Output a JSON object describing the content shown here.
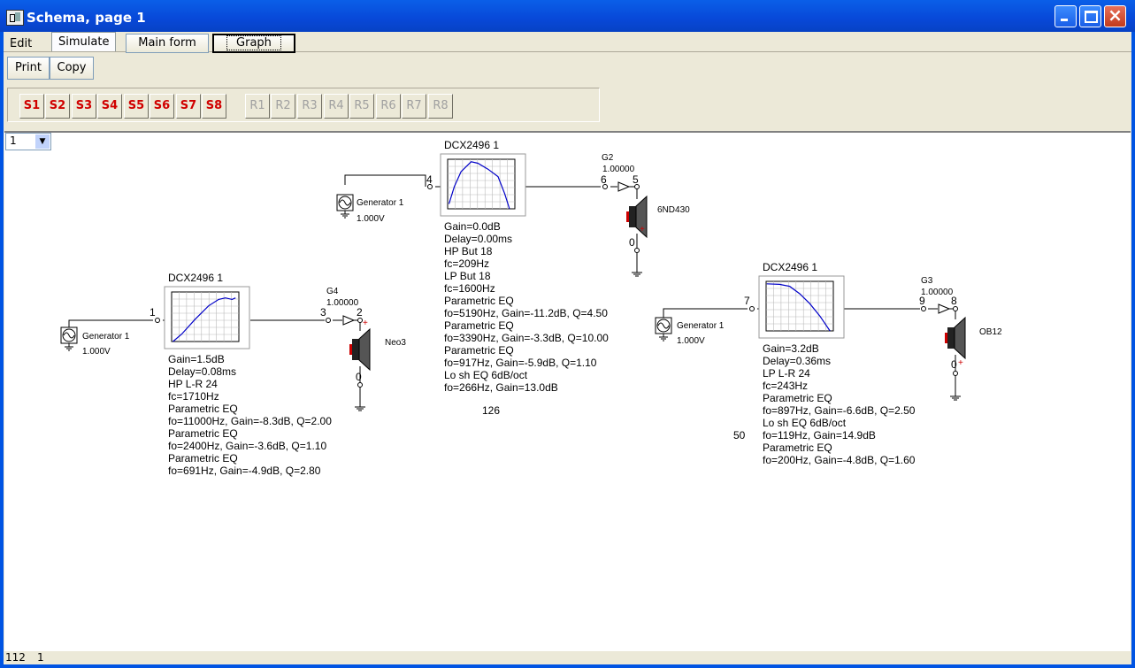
{
  "window": {
    "title": "Schema, page 1"
  },
  "menu": {
    "edit": "Edit",
    "simulate": "Simulate",
    "main_form": "Main form",
    "graph": "Graph",
    "print": "Print",
    "copy": "Copy"
  },
  "presets": {
    "s": [
      "S1",
      "S2",
      "S3",
      "S4",
      "S5",
      "S6",
      "S7",
      "S8"
    ],
    "r": [
      "R1",
      "R2",
      "R3",
      "R4",
      "R5",
      "R6",
      "R7",
      "R8"
    ]
  },
  "page_select": {
    "value": "1"
  },
  "schematic": {
    "ch2": {
      "gen_label": "Generator 1",
      "gen_volt": "1.000V",
      "in_node": "4",
      "dsp_title": "DCX2496 1",
      "out_node": "6",
      "amp_label": "G2",
      "amp_gain": "1.00000",
      "spk_node": "5",
      "spk_gnd_node": "0",
      "speaker": "6ND430",
      "params": [
        "Gain=0.0dB",
        "Delay=0.00ms",
        "HP But 18",
        " fc=209Hz",
        "LP But 18",
        " fc=1600Hz",
        "Parametric EQ",
        " fo=5190Hz, Gain=-11.2dB, Q=4.50",
        "Parametric EQ",
        " fo=3390Hz, Gain=-3.3dB, Q=10.00",
        "Parametric EQ",
        " fo=917Hz, Gain=-5.9dB, Q=1.10",
        "Lo sh EQ 6dB/oct",
        " fo=266Hz, Gain=13.0dB"
      ],
      "note": "126"
    },
    "ch1": {
      "gen_label": "Generator 1",
      "gen_volt": "1.000V",
      "in_node": "1",
      "dsp_title": "DCX2496 1",
      "out_node": "3",
      "amp_label": "G4",
      "amp_gain": "1.00000",
      "spk_node": "2",
      "spk_gnd_node": "0",
      "speaker": "Neo3",
      "params": [
        "Gain=1.5dB",
        "Delay=0.08ms",
        "HP L-R 24",
        " fc=1710Hz",
        "Parametric EQ",
        " fo=11000Hz, Gain=-8.3dB, Q=2.00",
        "Parametric EQ",
        " fo=2400Hz, Gain=-3.6dB, Q=1.10",
        "Parametric EQ",
        " fo=691Hz, Gain=-4.9dB, Q=2.80"
      ]
    },
    "ch3": {
      "gen_label": "Generator 1",
      "gen_volt": "1.000V",
      "in_node": "7",
      "dsp_title": "DCX2496 1",
      "out_node": "9",
      "amp_label": "G3",
      "amp_gain": "1.00000",
      "spk_node": "8",
      "spk_gnd_node": "0",
      "speaker": "OB12",
      "params": [
        "Gain=3.2dB",
        "Delay=0.36ms",
        "LP L-R 24",
        " fc=243Hz",
        "Parametric EQ",
        " fo=897Hz, Gain=-6.6dB, Q=2.50",
        "Lo sh EQ 6dB/oct",
        " fo=119Hz, Gain=14.9dB",
        "Parametric EQ",
        " fo=200Hz, Gain=-4.8dB, Q=1.60"
      ],
      "note": "50"
    }
  },
  "status": {
    "left": "112",
    "right": "1"
  },
  "colors": {
    "title_bar": "#0054e3",
    "preset_active": "#d00000",
    "preset_inactive": "#a0a0a0",
    "plot_curve": "#0000c8"
  }
}
